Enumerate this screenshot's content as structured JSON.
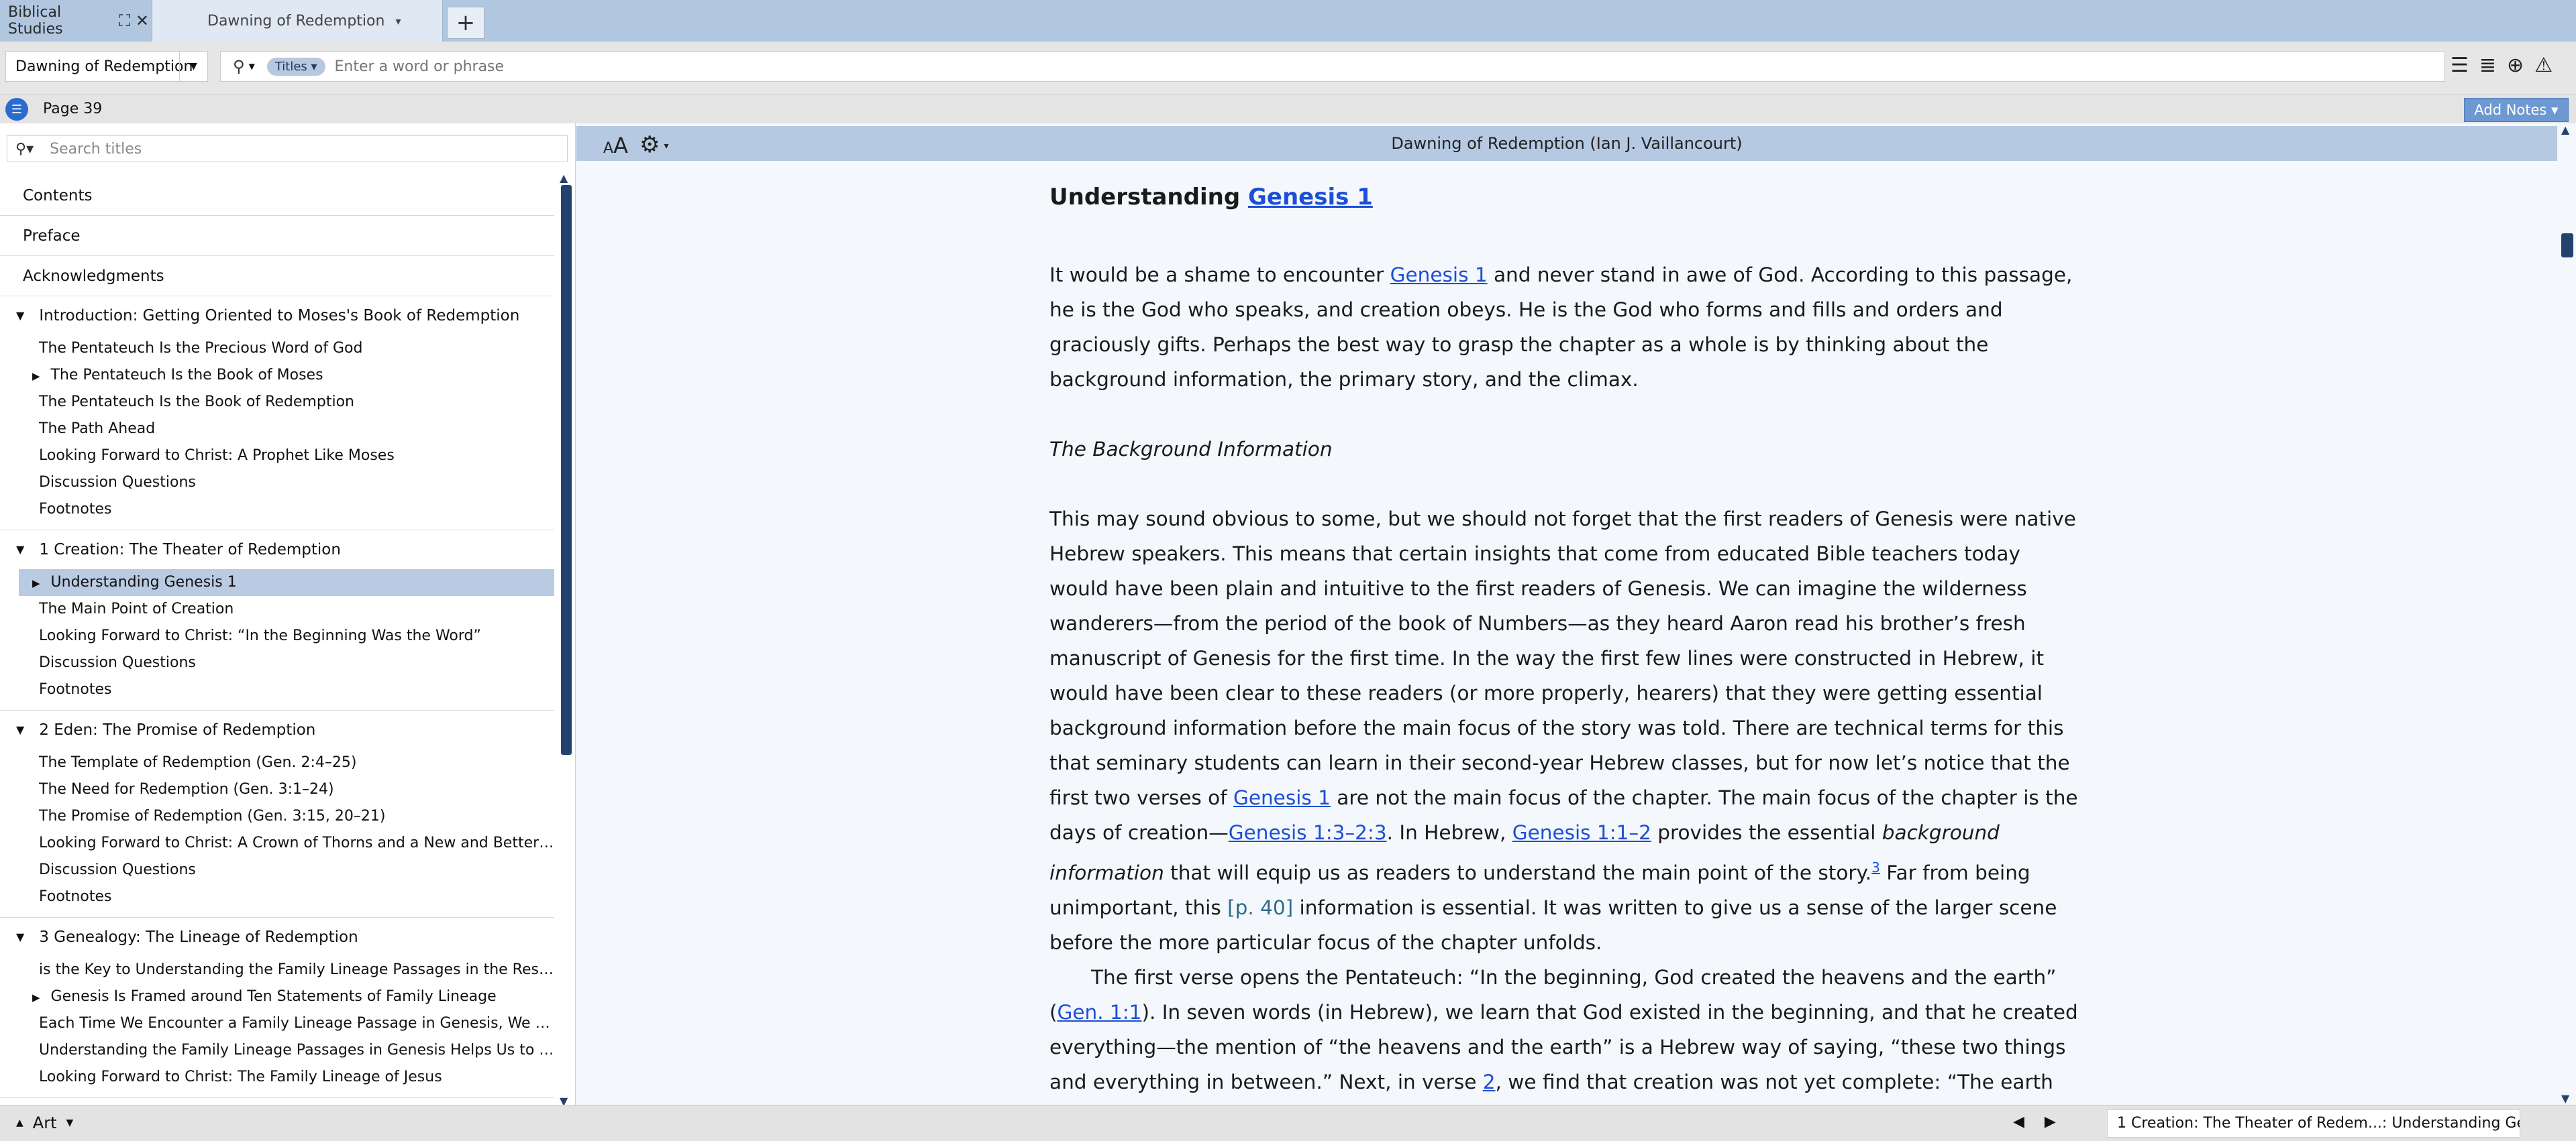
{
  "tabs": [
    {
      "label": "Biblical Studies"
    },
    {
      "label": "Dawning of Redemption"
    }
  ],
  "toolbar": {
    "resource_label": "Dawning of Redemption",
    "scope_chip": "Titles",
    "search_placeholder": "Enter a word or phrase"
  },
  "pagebar": {
    "page_label": "Page 39",
    "add_notes_label": "Add Notes"
  },
  "sidebar": {
    "search_placeholder": "Search titles",
    "top_items": [
      "Contents",
      "Preface",
      "Acknowledgments"
    ],
    "sections": [
      {
        "heading": "Introduction: Getting Oriented to Moses's Book of Redemption",
        "items": [
          {
            "label": "The Pentateuch Is the Precious Word of God",
            "expandable": false
          },
          {
            "label": "The Pentateuch Is the Book of Moses",
            "expandable": true
          },
          {
            "label": "The Pentateuch Is the Book of Redemption",
            "expandable": false
          },
          {
            "label": "The Path Ahead",
            "expandable": false
          },
          {
            "label": "Looking Forward to Christ: A Prophet Like Moses",
            "expandable": false
          },
          {
            "label": "Discussion Questions",
            "expandable": false
          },
          {
            "label": "Footnotes",
            "expandable": false
          }
        ]
      },
      {
        "heading": "1 Creation: The Theater of Redemption",
        "items": [
          {
            "label": "Understanding Genesis 1",
            "expandable": true,
            "selected": true
          },
          {
            "label": "The Main Point of Creation",
            "expandable": false
          },
          {
            "label": "Looking Forward to Christ: “In the Beginning Was the Word”",
            "expandable": false
          },
          {
            "label": "Discussion Questions",
            "expandable": false
          },
          {
            "label": "Footnotes",
            "expandable": false
          }
        ]
      },
      {
        "heading": "2 Eden: The Promise of Redemption",
        "items": [
          {
            "label": "The Template of Redemption (Gen. 2:4–25)",
            "expandable": false
          },
          {
            "label": "The Need for Redemption (Gen. 3:1–24)",
            "expandable": false
          },
          {
            "label": "The Promise of Redemption (Gen. 3:15, 20–21)",
            "expandable": false
          },
          {
            "label": "Looking Forward to Christ: A Crown of Thorns and a New and Better Ed...",
            "expandable": false
          },
          {
            "label": "Discussion Questions",
            "expandable": false
          },
          {
            "label": "Footnotes",
            "expandable": false
          }
        ]
      },
      {
        "heading": "3 Genealogy: The Lineage of Redemption",
        "items": [
          {
            "label": "is the Key to Understanding the Family Lineage Passages in the Rest of...",
            "expandable": false
          },
          {
            "label": "Genesis Is Framed around Ten Statements of Family Lineage",
            "expandable": true
          },
          {
            "label": "Each Time We Encounter a Family Lineage Passage in Genesis, We Nee...",
            "expandable": false
          },
          {
            "label": "Understanding the Family Lineage Passages in Genesis Helps Us to Inte...",
            "expandable": false
          },
          {
            "label": "Looking Forward to Christ: The Family Lineage of Jesus",
            "expandable": false
          }
        ]
      }
    ]
  },
  "reader": {
    "header_title": "Dawning of Redemption (Ian J. Vaillancourt)",
    "heading_text": "Understanding",
    "heading_link": "Genesis 1",
    "para1": {
      "t1": "It would be a shame to encounter ",
      "l1": "Genesis 1",
      "t2": " and never stand in awe of God. According to this passage, he is the God who speaks, and creation obeys. He is the God who forms and fills and orders and graciously gifts. Perhaps the best way to grasp the chapter as a whole is by thinking about the background information, the primary story, and the climax."
    },
    "subheading": "The Background Information",
    "para2": {
      "t1": "This may sound obvious to some, but we should not forget that the first readers of Genesis were native Hebrew speakers. This means that certain insights that come from educated Bible teachers today would have been plain and intuitive to the first readers of Genesis. We can imagine the wilderness wanderers—from the period of the book of Numbers—as they heard Aaron read his brother’s fresh manuscript of Genesis for the first time. In the way the first few lines were constructed in Hebrew, it would have been clear to these readers (or more properly, hearers) that they were getting essential background information before the main focus of the story was told. There are technical terms for this that seminary students can learn in their second-year Hebrew classes, but for now let’s notice that the first two verses of ",
      "l1": "Genesis 1",
      "t2": " are not the main focus of the chapter. The main focus of the chapter is the days of creation—",
      "l2": "Genesis 1:3–2:3",
      "t3": ". In Hebrew, ",
      "l3": "Genesis 1:1–2",
      "t4": " provides the essential ",
      "em": "background information",
      "t5": " that will equip us as readers to understand the main point of the story.",
      "fn": "3",
      "t6": " Far from being unimportant, this ",
      "page_marker": "[p. 40]",
      "t7": " information is essential. It was written to give us a sense of the larger scene before the more particular focus of the chapter unfolds."
    },
    "para3": {
      "t1": "The first verse opens the Pentateuch: “In the beginning, God created the heavens and the earth” (",
      "l1": "Gen. 1:1",
      "t2": "). In seven words (in Hebrew), we learn that God existed in the beginning, and that he created everything—the mention of “the heavens and the earth” is a Hebrew way of saying, “these two things and everything in between.” Next, in verse ",
      "l2": "2",
      "t3": ", we find that creation was not yet complete: “The earth was without form and void, and darkness was over the face of the deep. And the Spirit of God was hovering over the face of the waters.”"
    }
  },
  "statusbar": {
    "art_label": "Art",
    "location": "1 Creation: The Theater of Redem...: Understanding Ge..."
  },
  "colors": {
    "tabbar": "#b1c6df",
    "reader_header": "#b5c9e2",
    "link": "#1c4fd6",
    "accent_button": "#6e98d1",
    "selected_item": "#b9cbe2"
  },
  "icons": [
    "maximize-icon",
    "close-icon",
    "new-tab-icon",
    "search-icon",
    "list-icon",
    "align-icon",
    "add-icon",
    "share-icon",
    "toc-icon",
    "font-size-icon",
    "gear-icon"
  ]
}
